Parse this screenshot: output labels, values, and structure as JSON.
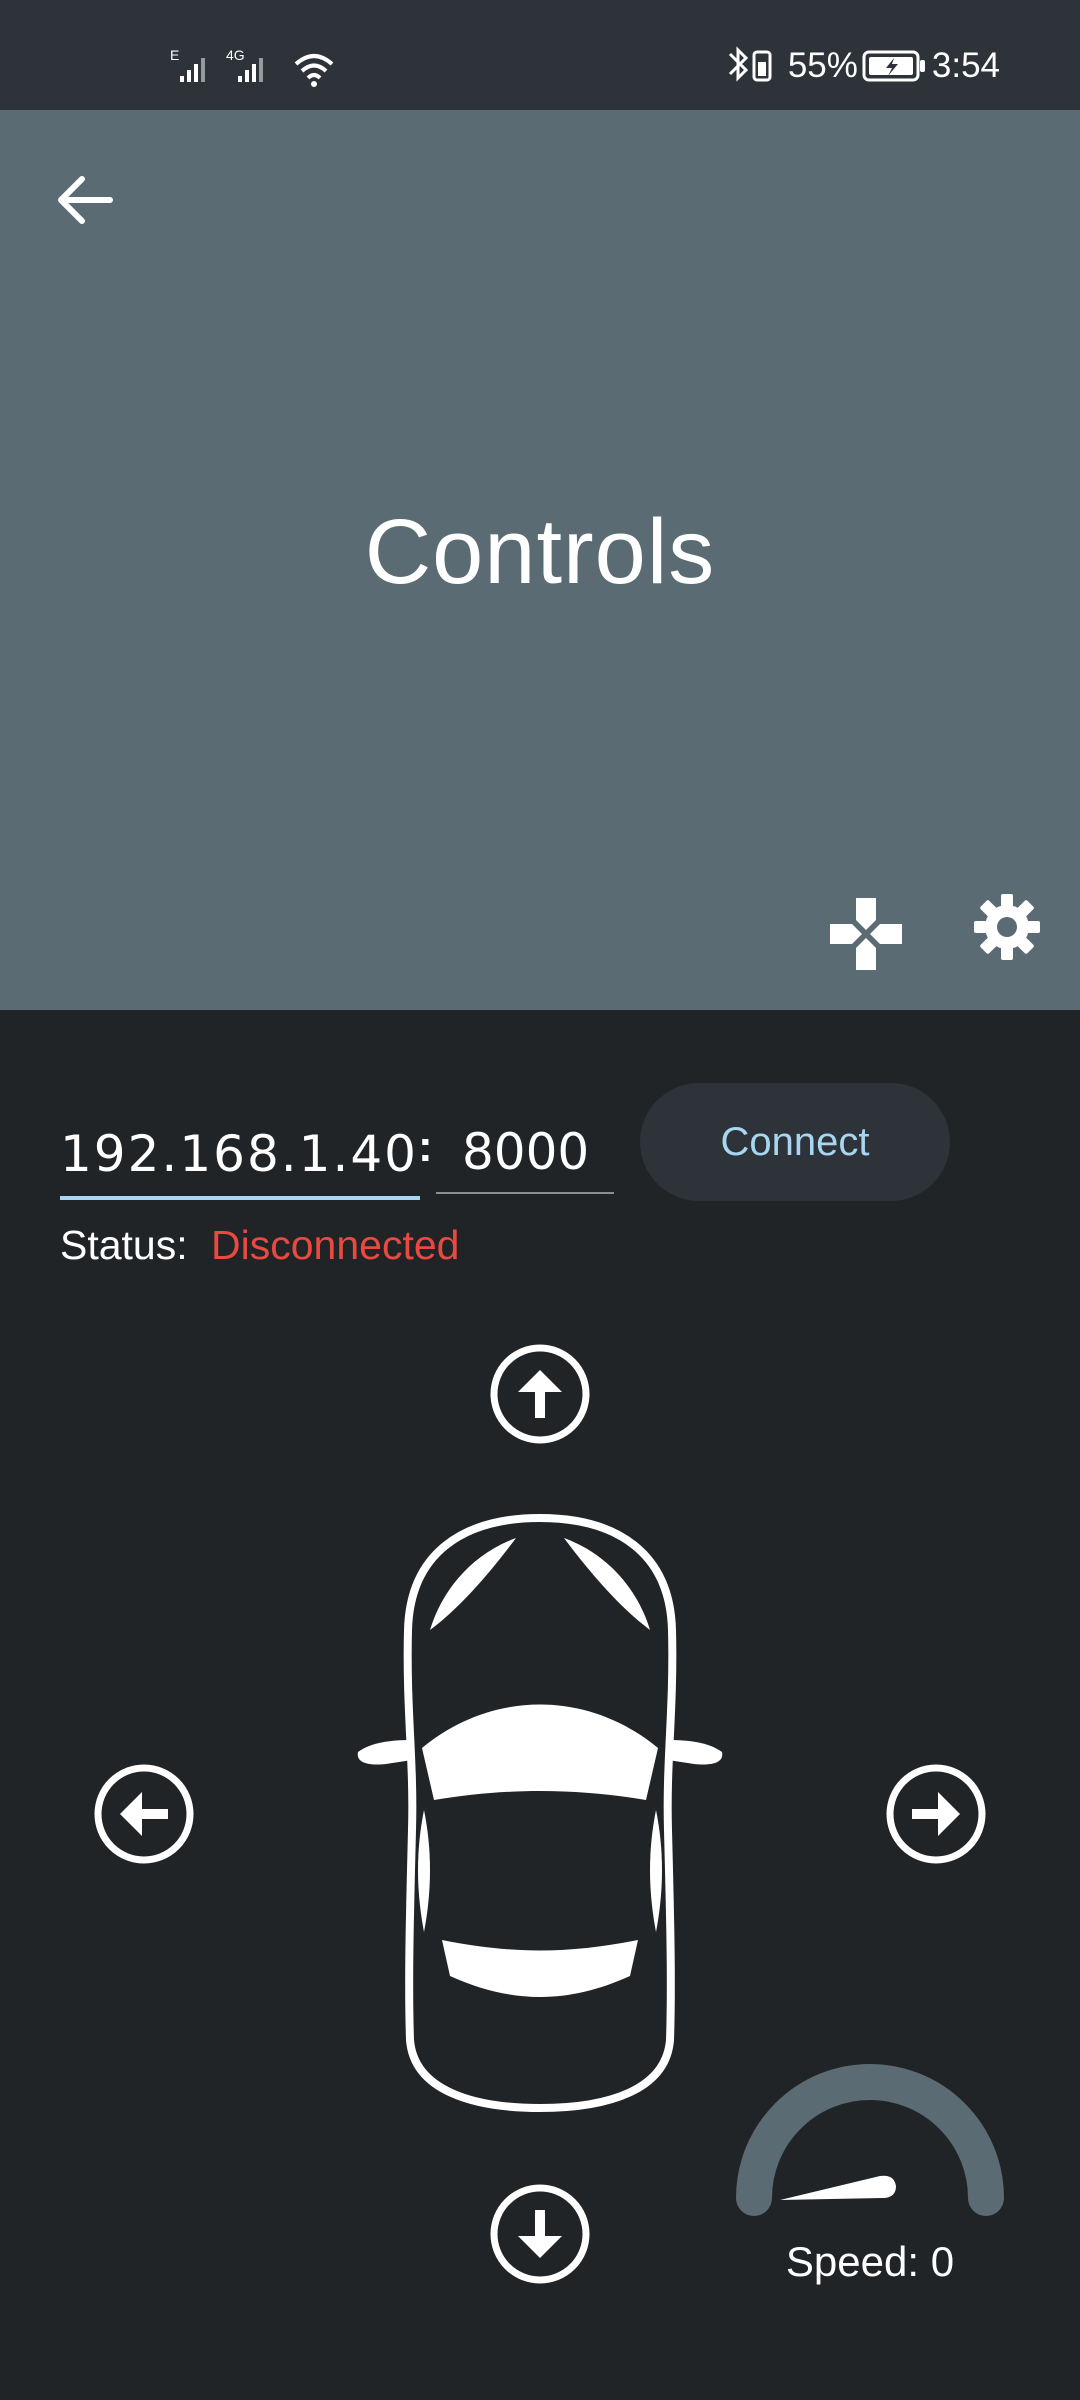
{
  "statusbar": {
    "signal_1": "E",
    "signal_2": "4G",
    "battery_percent": "55%",
    "time": "3:54"
  },
  "appbar": {
    "title": "Controls",
    "back_icon": "arrow-left-icon",
    "gamepad_icon": "gamepad-icon",
    "settings_icon": "gear-icon"
  },
  "connection": {
    "ip_value": "192.168.1.40",
    "separator": ":",
    "port_value": "8000",
    "connect_label": "Connect",
    "status_label": "Status:",
    "status_value": "Disconnected"
  },
  "controls": {
    "up_icon": "arrow-up-circle-icon",
    "down_icon": "arrow-down-circle-icon",
    "left_icon": "arrow-left-circle-icon",
    "right_icon": "arrow-right-circle-icon",
    "car_icon": "car-topview-icon"
  },
  "speed": {
    "label": "Speed: 0",
    "value": 0
  },
  "colors": {
    "appbar_bg": "#5b6b73",
    "page_bg": "#212427",
    "accent": "#a8d5f0",
    "status_error": "#e84a3f"
  }
}
